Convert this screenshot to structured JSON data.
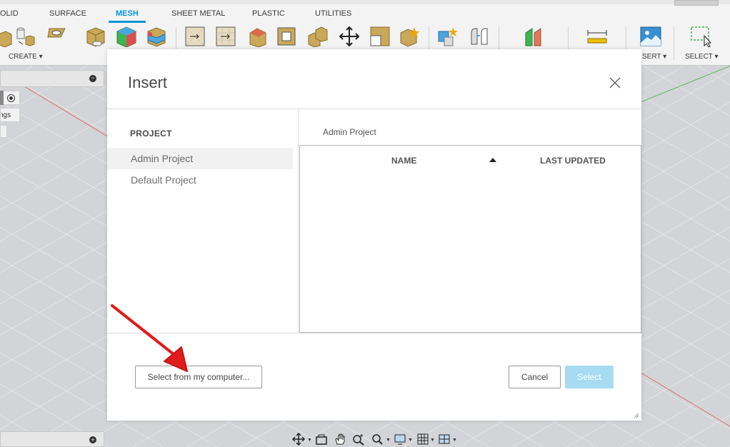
{
  "toolbar": {
    "tabs": [
      {
        "label": "OLID",
        "active": false
      },
      {
        "label": "SURFACE",
        "active": false
      },
      {
        "label": "MESH",
        "active": true
      },
      {
        "label": "SHEET METAL",
        "active": false
      },
      {
        "label": "PLASTIC",
        "active": false
      },
      {
        "label": "UTILITIES",
        "active": false
      }
    ],
    "groups": {
      "create": "CREATE ▾",
      "insert": "SERT ▾",
      "select": "SELECT ▾"
    },
    "accent_color": "#0696d7"
  },
  "browser": {
    "settings_label": "ngs"
  },
  "dialog": {
    "title": "Insert",
    "close_icon": "close-icon",
    "section_label": "PROJECT",
    "projects": [
      {
        "name": "Admin Project",
        "selected": true
      },
      {
        "name": "Default Project",
        "selected": false
      }
    ],
    "breadcrumb": "Admin Project",
    "table": {
      "columns": [
        "NAME",
        "LAST UPDATED"
      ],
      "sort": "ascending",
      "rows": []
    },
    "buttons": {
      "select_from_computer": "Select from my computer...",
      "cancel": "Cancel",
      "select": "Select"
    },
    "primary_disabled_color": "#a7dbf2"
  },
  "annotation": {
    "arrow_color": "#e01b1b"
  }
}
